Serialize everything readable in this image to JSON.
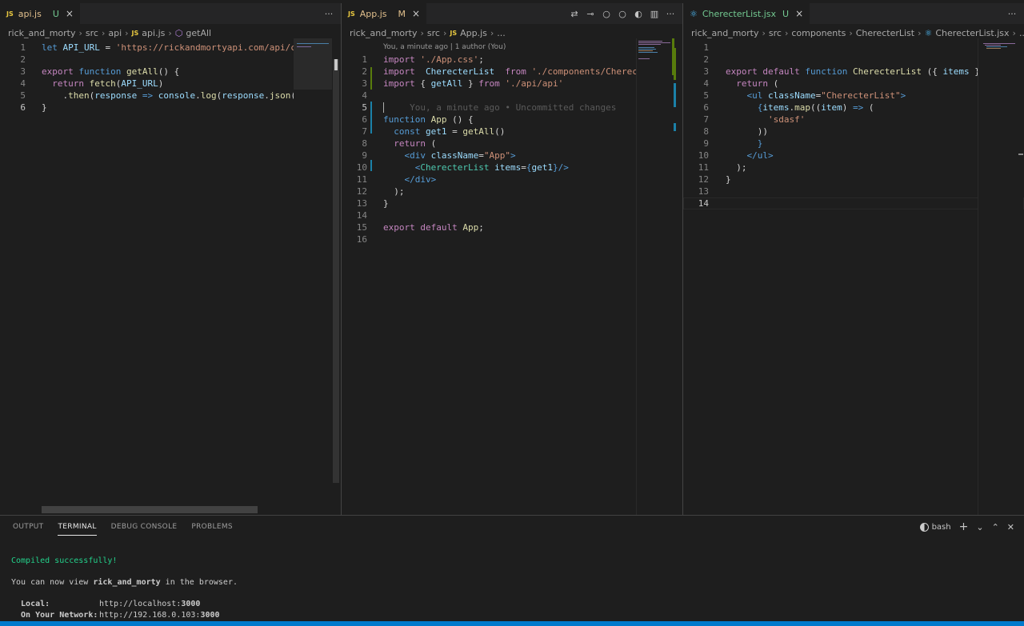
{
  "panes": {
    "left": {
      "tab": {
        "icon": "JS",
        "name": "api.js",
        "status": "U",
        "close": "×"
      },
      "more": "···",
      "breadcrumb": [
        "rick_and_morty",
        "src",
        "api",
        "api.js",
        "getAll"
      ],
      "lines": [
        {
          "n": "1",
          "cur": false,
          "tokens": [
            [
              "kw",
              "let "
            ],
            [
              "var",
              "API_URL"
            ],
            [
              "plain",
              " = "
            ],
            [
              "str",
              "'"
            ],
            [
              "str",
              "https://rickandmortyapi.com/api/charac"
            ]
          ]
        },
        {
          "n": "2",
          "cur": false,
          "tokens": []
        },
        {
          "n": "3",
          "cur": false,
          "tokens": [
            [
              "kw2",
              "export "
            ],
            [
              "kw",
              "function "
            ],
            [
              "fn",
              "getAll"
            ],
            [
              "plain",
              "() {"
            ]
          ]
        },
        {
          "n": "4",
          "cur": false,
          "tokens": [
            [
              "plain",
              "  "
            ],
            [
              "kw2",
              "return "
            ],
            [
              "fn",
              "fetch"
            ],
            [
              "plain",
              "("
            ],
            [
              "var",
              "API_URL"
            ],
            [
              "plain",
              ")"
            ]
          ]
        },
        {
          "n": "5",
          "cur": false,
          "tokens": [
            [
              "plain",
              "    ."
            ],
            [
              "fn",
              "then"
            ],
            [
              "plain",
              "("
            ],
            [
              "var",
              "response"
            ],
            [
              "kw",
              " => "
            ],
            [
              "var",
              "console"
            ],
            [
              "plain",
              "."
            ],
            [
              "fn",
              "log"
            ],
            [
              "plain",
              "("
            ],
            [
              "var",
              "response"
            ],
            [
              "plain",
              "."
            ],
            [
              "fn",
              "json"
            ],
            [
              "plain",
              "()));"
            ]
          ]
        },
        {
          "n": "6",
          "cur": true,
          "tokens": [
            [
              "plain",
              "}"
            ]
          ]
        }
      ]
    },
    "middle": {
      "tab": {
        "icon": "JS",
        "name": "App.js",
        "status": "M",
        "close": "×"
      },
      "actions": [
        "⇄",
        "⊸",
        "○",
        "○",
        "◐",
        "▥",
        "···"
      ],
      "breadcrumb": [
        "rick_and_morty",
        "src",
        "App.js",
        "..."
      ],
      "blame": "You, a minute ago | 1 author (You)",
      "lines": [
        {
          "n": "1",
          "cur": false,
          "tokens": [
            [
              "kw2",
              "import "
            ],
            [
              "str",
              "'./App.css'"
            ],
            [
              "plain",
              ";"
            ]
          ]
        },
        {
          "n": "2",
          "cur": false,
          "tokens": [
            [
              "kw2",
              "import  "
            ],
            [
              "var",
              "CherecterList"
            ],
            [
              "kw2",
              "  from "
            ],
            [
              "str",
              "'./components/CherecterL"
            ]
          ]
        },
        {
          "n": "3",
          "cur": false,
          "tokens": [
            [
              "kw2",
              "import "
            ],
            [
              "plain",
              "{ "
            ],
            [
              "var",
              "getAll"
            ],
            [
              "plain",
              " } "
            ],
            [
              "kw2",
              "from "
            ],
            [
              "str",
              "'./api/api'"
            ]
          ]
        },
        {
          "n": "4",
          "cur": false,
          "tokens": []
        },
        {
          "n": "5",
          "cur": true,
          "tokens": [
            [
              "ghost",
              "     You, a minute ago • Uncommitted changes"
            ]
          ]
        },
        {
          "n": "6",
          "cur": false,
          "tokens": [
            [
              "kw",
              "function "
            ],
            [
              "fn",
              "App "
            ],
            [
              "plain",
              "() {"
            ]
          ]
        },
        {
          "n": "7",
          "cur": false,
          "tokens": [
            [
              "plain",
              "  "
            ],
            [
              "kw",
              "const "
            ],
            [
              "var",
              "get1"
            ],
            [
              "plain",
              " = "
            ],
            [
              "fn",
              "getAll"
            ],
            [
              "plain",
              "()"
            ]
          ]
        },
        {
          "n": "8",
          "cur": false,
          "tokens": [
            [
              "plain",
              "  "
            ],
            [
              "kw2",
              "return "
            ],
            [
              "plain",
              "("
            ]
          ]
        },
        {
          "n": "9",
          "cur": false,
          "tokens": [
            [
              "plain",
              "    "
            ],
            [
              "tag",
              "<div "
            ],
            [
              "attr",
              "className"
            ],
            [
              "plain",
              "="
            ],
            [
              "str",
              "\"App\""
            ],
            [
              "tag",
              ">"
            ]
          ]
        },
        {
          "n": "10",
          "cur": false,
          "tokens": [
            [
              "plain",
              "      "
            ],
            [
              "tag",
              "<"
            ],
            [
              "cmp",
              "CherecterList "
            ],
            [
              "attr",
              "items"
            ],
            [
              "plain",
              "="
            ],
            [
              "tag",
              "{"
            ],
            [
              "var",
              "get1"
            ],
            [
              "tag",
              "}"
            ],
            [
              "tag",
              "/>"
            ]
          ]
        },
        {
          "n": "11",
          "cur": false,
          "tokens": [
            [
              "plain",
              "    "
            ],
            [
              "tag",
              "</div>"
            ]
          ]
        },
        {
          "n": "12",
          "cur": false,
          "tokens": [
            [
              "plain",
              "  );"
            ]
          ]
        },
        {
          "n": "13",
          "cur": false,
          "tokens": [
            [
              "plain",
              "}"
            ]
          ]
        },
        {
          "n": "14",
          "cur": false,
          "tokens": []
        },
        {
          "n": "15",
          "cur": false,
          "tokens": [
            [
              "kw2",
              "export default "
            ],
            [
              "fn",
              "App"
            ],
            [
              "plain",
              ";"
            ]
          ]
        },
        {
          "n": "16",
          "cur": false,
          "tokens": []
        }
      ]
    },
    "right": {
      "tab": {
        "icon": "⚛",
        "name": "CherecterList.jsx",
        "status": "U",
        "close": "×"
      },
      "more": "···",
      "breadcrumb": [
        "rick_and_morty",
        "src",
        "components",
        "CherecterList",
        "CherecterList.jsx",
        "..."
      ],
      "lines": [
        {
          "n": "1",
          "cur": false,
          "tokens": []
        },
        {
          "n": "2",
          "cur": false,
          "tokens": []
        },
        {
          "n": "3",
          "cur": false,
          "tokens": [
            [
              "kw2",
              "export default "
            ],
            [
              "kw",
              "function "
            ],
            [
              "fn",
              "CherecterList "
            ],
            [
              "plain",
              "({ "
            ],
            [
              "var",
              "items"
            ],
            [
              "plain",
              " }) {"
            ]
          ]
        },
        {
          "n": "4",
          "cur": false,
          "tokens": [
            [
              "plain",
              "  "
            ],
            [
              "kw2",
              "return "
            ],
            [
              "plain",
              "("
            ]
          ]
        },
        {
          "n": "5",
          "cur": false,
          "tokens": [
            [
              "plain",
              "    "
            ],
            [
              "tag",
              "<ul "
            ],
            [
              "attr",
              "className"
            ],
            [
              "plain",
              "="
            ],
            [
              "str",
              "\"CherecterList\""
            ],
            [
              "tag",
              ">"
            ]
          ]
        },
        {
          "n": "6",
          "cur": false,
          "tokens": [
            [
              "plain",
              "      "
            ],
            [
              "tag",
              "{"
            ],
            [
              "var",
              "items"
            ],
            [
              "plain",
              "."
            ],
            [
              "fn",
              "map"
            ],
            [
              "plain",
              "(("
            ],
            [
              "var",
              "item"
            ],
            [
              "plain",
              ") "
            ],
            [
              "kw",
              "=>"
            ],
            [
              "plain",
              " ("
            ]
          ]
        },
        {
          "n": "7",
          "cur": false,
          "tokens": [
            [
              "plain",
              "        "
            ],
            [
              "str",
              "'sdasf'"
            ]
          ]
        },
        {
          "n": "8",
          "cur": false,
          "tokens": [
            [
              "plain",
              "      ))"
            ]
          ]
        },
        {
          "n": "9",
          "cur": false,
          "tokens": [
            [
              "plain",
              "      "
            ],
            [
              "tag",
              "}"
            ]
          ]
        },
        {
          "n": "10",
          "cur": false,
          "tokens": [
            [
              "plain",
              "    "
            ],
            [
              "tag",
              "</ul>"
            ]
          ]
        },
        {
          "n": "11",
          "cur": false,
          "tokens": [
            [
              "plain",
              "  );"
            ]
          ]
        },
        {
          "n": "12",
          "cur": false,
          "tokens": [
            [
              "plain",
              "}"
            ]
          ]
        },
        {
          "n": "13",
          "cur": false,
          "tokens": []
        },
        {
          "n": "14",
          "cur": true,
          "tokens": []
        }
      ]
    }
  },
  "panel": {
    "tabs": [
      "OUTPUT",
      "TERMINAL",
      "DEBUG CONSOLE",
      "PROBLEMS"
    ],
    "active_tab": "TERMINAL",
    "shell": "bash",
    "actions": {
      "add": "+",
      "chevron": "⌄",
      "maximize": "⌃",
      "close": "✕"
    },
    "terminal": {
      "compiled": "Compiled successfully!",
      "view_prefix": "You can now view ",
      "app_name": "rick_and_morty",
      "view_suffix": " in the browser.",
      "local_label": "  Local:",
      "local_url_prefix": "http://localhost:",
      "local_port": "3000",
      "network_label": "  On Your Network:",
      "network_url_prefix": "http://192.168.0.103:",
      "network_port": "3000"
    }
  },
  "colors": {
    "accent": "#007acc",
    "success": "#23d18b"
  }
}
